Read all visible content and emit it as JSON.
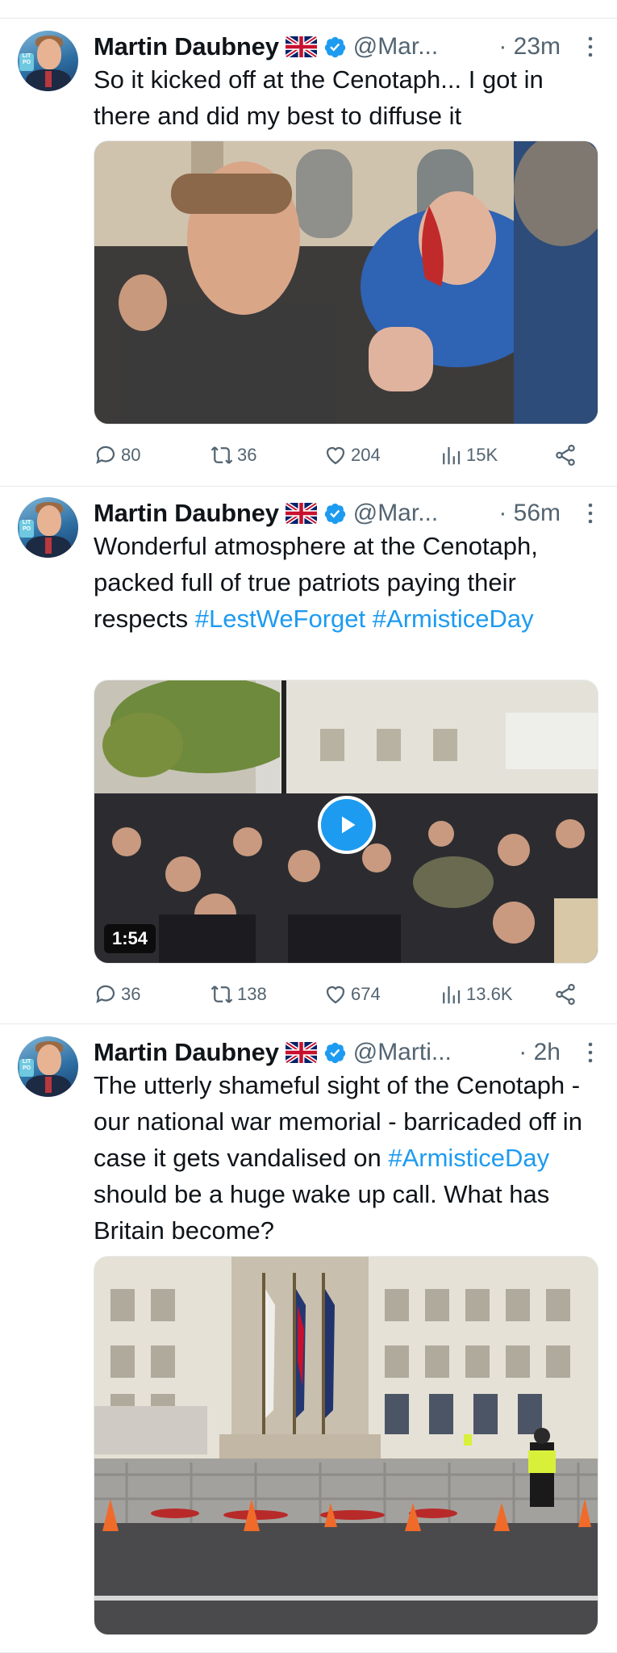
{
  "tweets": [
    {
      "author": "Martin Daubney",
      "handle": "@Mar...",
      "time": "· 23m",
      "text": "So it kicked off at the Cenotaph... I got in there and did my best to diffuse it",
      "media_type": "photo",
      "stats": {
        "replies": "80",
        "retweets": "36",
        "likes": "204",
        "views": "15K"
      }
    },
    {
      "author": "Martin Daubney",
      "handle": "@Mar...",
      "time": "· 56m",
      "text_parts": [
        "Wonderful atmosphere at the Cenotaph, packed full of true patriots paying their respects ",
        "#LestWeForget",
        " ",
        "#ArmisticeDay"
      ],
      "media_type": "video",
      "video_duration": "1:54",
      "stats": {
        "replies": "36",
        "retweets": "138",
        "likes": "674",
        "views": "13.6K"
      }
    },
    {
      "author": "Martin Daubney",
      "handle": "@Marti...",
      "time": "· 2h",
      "text_parts": [
        "The utterly shameful sight of the Cenotaph - our national war memorial - barricaded off in case it gets vandalised on ",
        "#ArmisticeDay",
        " should be a huge wake up call. What has Britain become?"
      ],
      "media_type": "photo"
    }
  ],
  "avatar_badge": "LIT PO",
  "colors": {
    "accent": "#1d9bf0",
    "secondary_text": "#536471",
    "divider": "#e6e9ec"
  },
  "icons": [
    "reply-icon",
    "retweet-icon",
    "like-icon",
    "views-icon",
    "share-icon",
    "verified-badge-icon",
    "uk-flag-icon",
    "more-icon",
    "play-icon"
  ]
}
